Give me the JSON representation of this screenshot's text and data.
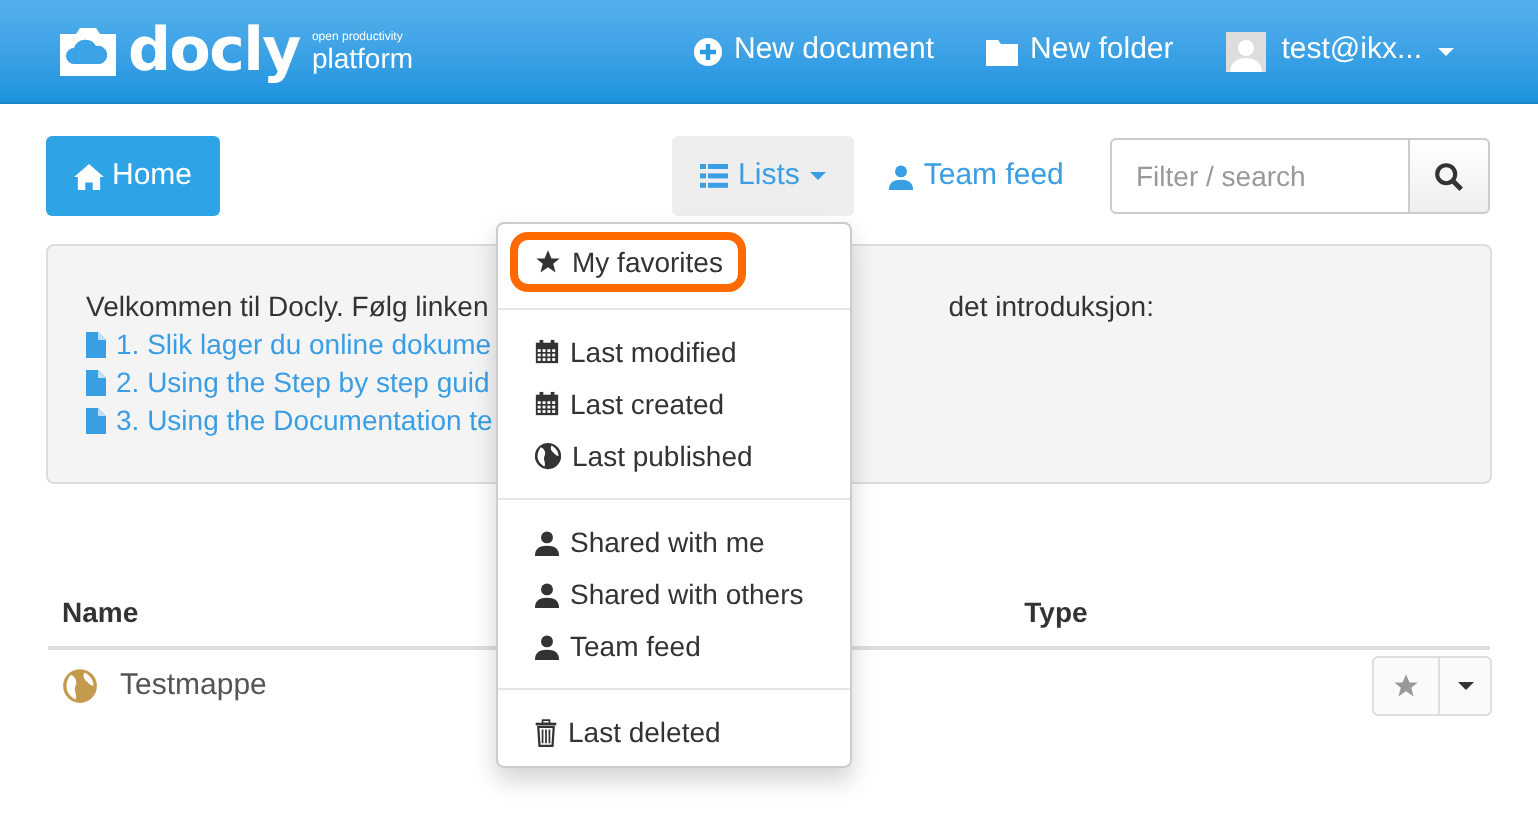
{
  "header": {
    "logo": {
      "name": "docly",
      "tagline_top": "open productivity",
      "tagline_bottom": "platform"
    },
    "nav": [
      {
        "kind": "plus",
        "label": "New document"
      },
      {
        "kind": "folder",
        "label": "New folder"
      }
    ],
    "user": "test@ikx..."
  },
  "toolbar": {
    "home": "Home",
    "lists": "Lists",
    "team_feed": "Team feed",
    "search": {
      "placeholder": "Filter / search"
    }
  },
  "welcome": {
    "intro_start": "Velkommen til Docly. Følg linken",
    "intro_end": "det introduksjon:",
    "links": [
      "1. Slik lager du online dokume",
      "2. Using the Step by step guid",
      "3. Using the Documentation te"
    ]
  },
  "dropdown": {
    "groups": [
      [
        {
          "kind": "star",
          "label": "My favorites",
          "highlighted": true
        }
      ],
      [
        {
          "kind": "calendar",
          "label": "Last modified",
          "highlighted": false
        },
        {
          "kind": "calendar",
          "label": "Last created",
          "highlighted": false
        },
        {
          "kind": "globe",
          "label": "Last published",
          "highlighted": false
        }
      ],
      [
        {
          "kind": "user",
          "label": "Shared with me",
          "highlighted": false
        },
        {
          "kind": "user",
          "label": "Shared with others",
          "highlighted": false
        },
        {
          "kind": "user",
          "label": "Team feed",
          "highlighted": false
        }
      ],
      [
        {
          "kind": "trash",
          "label": "Last deleted",
          "highlighted": false
        }
      ]
    ]
  },
  "table": {
    "columns": [
      "Name",
      "Type"
    ],
    "rows": [
      {
        "name": "Testmappe"
      }
    ]
  }
}
